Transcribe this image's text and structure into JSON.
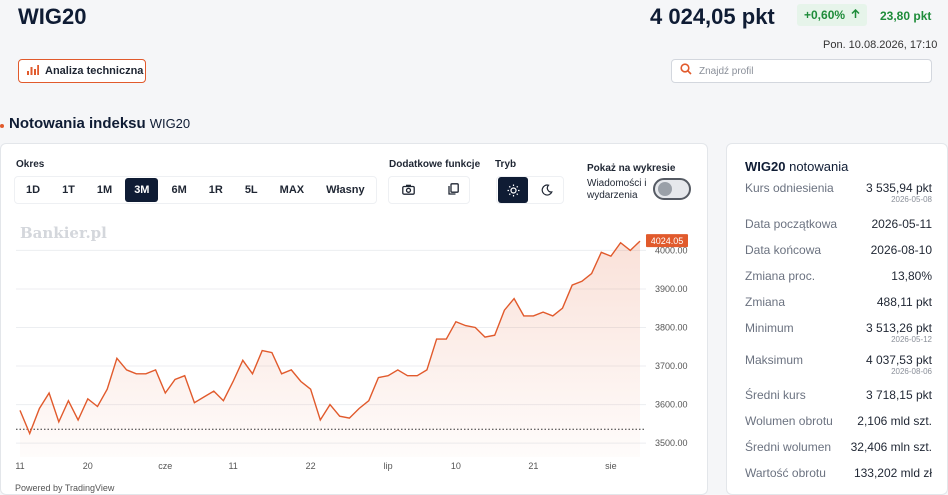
{
  "header": {
    "title": "WIG20",
    "price": "4 024,05 pkt",
    "change_pct": "+0,60%",
    "change_abs": "23,80 pkt",
    "datetime": "Pon. 10.08.2026, 17:10",
    "tech_button": "Analiza techniczna",
    "search_placeholder": "Znajdź profil"
  },
  "section": {
    "title": "Notowania indeksu",
    "subtitle": "WIG20"
  },
  "controls": {
    "period_label": "Okres",
    "periods": [
      "1D",
      "1T",
      "1M",
      "3M",
      "6M",
      "1R",
      "5L",
      "MAX",
      "Własny"
    ],
    "active_period": "3M",
    "extra_label": "Dodatkowe funkcje",
    "mode_label": "Tryb",
    "show_label": "Pokaż na wykresie",
    "news_label": "Wiadomości i wydarzenia"
  },
  "chart": {
    "watermark": "Bankier.pl",
    "powered_by": "Powered by TradingView",
    "last_label": "4024.05",
    "accent": "#e15a2c"
  },
  "chart_data": {
    "type": "area",
    "y_ticks": [
      "4000.00",
      "3900.00",
      "3800.00",
      "3700.00",
      "3600.00",
      "3500.00"
    ],
    "ylim": [
      3490,
      4040
    ],
    "x_ticks": [
      {
        "label": "11",
        "i": 0
      },
      {
        "label": "20",
        "i": 7
      },
      {
        "label": "cze",
        "i": 15
      },
      {
        "label": "11",
        "i": 22
      },
      {
        "label": "22",
        "i": 30
      },
      {
        "label": "lip",
        "i": 38
      },
      {
        "label": "10",
        "i": 45
      },
      {
        "label": "21",
        "i": 53
      },
      {
        "label": "sie",
        "i": 61
      },
      {
        "label": "",
        "i": 67
      }
    ],
    "baseline": 3535.94,
    "last_value": 4024.05,
    "values": [
      3585,
      3525,
      3590,
      3630,
      3555,
      3610,
      3560,
      3615,
      3595,
      3640,
      3720,
      3690,
      3680,
      3680,
      3690,
      3630,
      3665,
      3675,
      3605,
      3620,
      3635,
      3610,
      3660,
      3715,
      3680,
      3740,
      3735,
      3680,
      3690,
      3660,
      3640,
      3560,
      3600,
      3570,
      3565,
      3590,
      3610,
      3670,
      3675,
      3690,
      3675,
      3675,
      3690,
      3770,
      3770,
      3815,
      3805,
      3800,
      3775,
      3780,
      3845,
      3875,
      3830,
      3830,
      3840,
      3830,
      3850,
      3910,
      3920,
      3940,
      3995,
      3985,
      4020,
      4000,
      4024.05
    ]
  },
  "stats": {
    "title_bold": "WIG20",
    "title_rest": "notowania",
    "rows": [
      {
        "label": "Kurs odniesienia",
        "value": "3 535,94 pkt",
        "date": "2026-05-08"
      },
      {
        "label": "Data początkowa",
        "value": "2026-05-11",
        "date": ""
      },
      {
        "label": "Data końcowa",
        "value": "2026-08-10",
        "date": ""
      },
      {
        "label": "Zmiana proc.",
        "value": "13,80%",
        "date": ""
      },
      {
        "label": "Zmiana",
        "value": "488,11 pkt",
        "date": ""
      },
      {
        "label": "Minimum",
        "value": "3 513,26 pkt",
        "date": "2026-05-12"
      },
      {
        "label": "Maksimum",
        "value": "4 037,53 pkt",
        "date": "2026-08-06"
      },
      {
        "label": "Średni kurs",
        "value": "3 718,15 pkt",
        "date": ""
      },
      {
        "label": "Wolumen obrotu",
        "value": "2,106 mld szt.",
        "date": ""
      },
      {
        "label": "Średni wolumen",
        "value": "32,406 mln szt.",
        "date": ""
      },
      {
        "label": "Wartość obrotu",
        "value": "133,202 mld zł",
        "date": ""
      }
    ]
  }
}
